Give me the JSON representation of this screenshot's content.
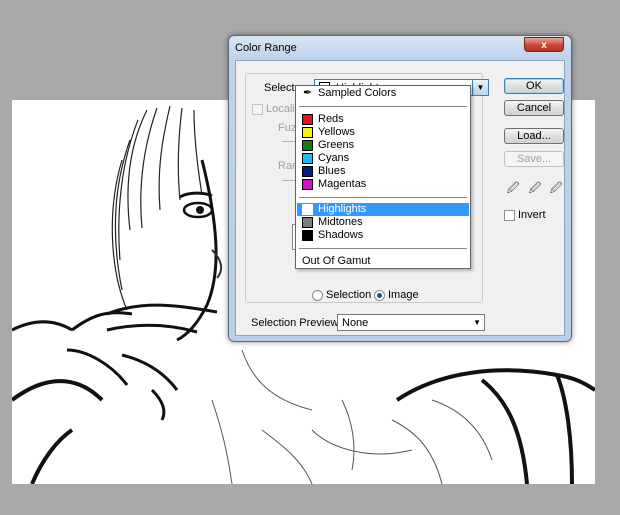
{
  "dialog": {
    "title": "Color Range",
    "close_label": "x",
    "select_label": "Select:",
    "select_value": "Highlights",
    "localize_label": "Localize",
    "fuzziness_label": "Fuzz",
    "range_label": "Rang",
    "selection_radio_label": "Selection",
    "image_radio_label": "Image",
    "image_radio_checked": true,
    "selection_preview_label": "Selection Preview:",
    "selection_preview_value": "None",
    "invert_label": "Invert",
    "buttons": {
      "ok": "OK",
      "cancel": "Cancel",
      "load": "Load...",
      "save": "Save..."
    }
  },
  "dropdown": {
    "sampled_colors": "Sampled Colors",
    "colors": [
      {
        "label": "Reds",
        "swatch": "#e8131b"
      },
      {
        "label": "Yellows",
        "swatch": "#f5f20c"
      },
      {
        "label": "Greens",
        "swatch": "#127a1a"
      },
      {
        "label": "Cyans",
        "swatch": "#21b8ee"
      },
      {
        "label": "Blues",
        "swatch": "#0b1b78"
      },
      {
        "label": "Magentas",
        "swatch": "#d10fc6"
      }
    ],
    "tones": [
      {
        "label": "Highlights",
        "swatch": "#ffffff",
        "selected": true
      },
      {
        "label": "Midtones",
        "swatch": "#7d7d7d",
        "selected": false
      },
      {
        "label": "Shadows",
        "swatch": "#000000",
        "selected": false
      }
    ],
    "out_of_gamut": "Out Of Gamut"
  },
  "colors": {
    "selection_highlight": "#3399ff",
    "title_bar": "#bfd3ec",
    "close_button": "#c9473a"
  }
}
